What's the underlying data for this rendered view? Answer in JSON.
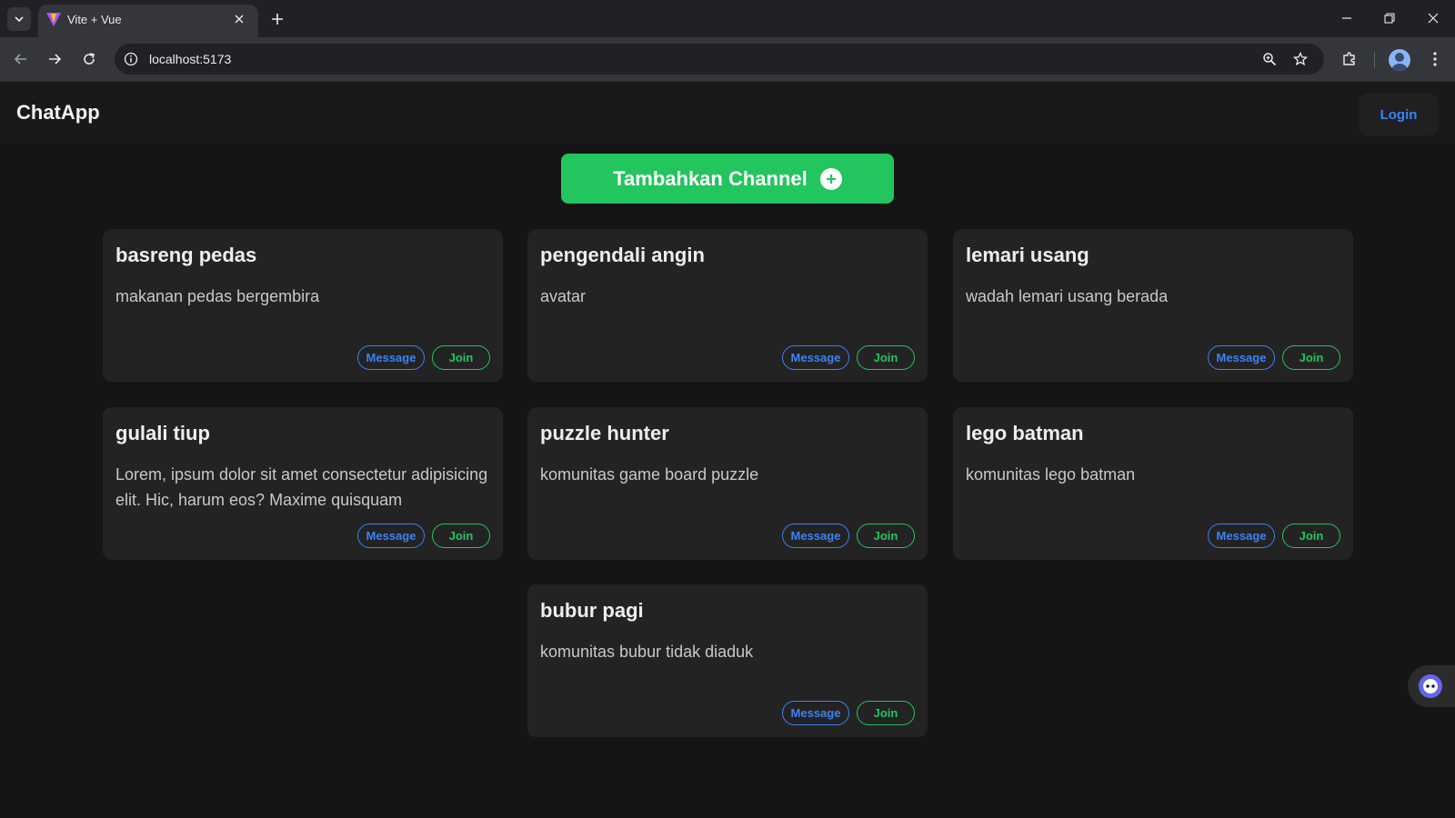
{
  "browser": {
    "tab_title": "Vite + Vue",
    "url": "localhost:5173"
  },
  "app": {
    "brand": "ChatApp",
    "login_label": "Login",
    "add_channel_label": "Tambahkan Channel"
  },
  "colors": {
    "accent_green": "#22c55e",
    "accent_blue": "#3b82f6",
    "card_bg": "#232323",
    "page_bg": "#151515"
  },
  "channels": [
    {
      "name": "basreng pedas",
      "description": "makanan pedas bergembira",
      "message_label": "Message",
      "join_label": "Join"
    },
    {
      "name": "pengendali angin",
      "description": "avatar",
      "message_label": "Message",
      "join_label": "Join"
    },
    {
      "name": "lemari usang",
      "description": "wadah lemari usang berada",
      "message_label": "Message",
      "join_label": "Join"
    },
    {
      "name": "gulali tiup",
      "description": "Lorem, ipsum dolor sit amet consectetur adipisicing elit. Hic, harum eos? Maxime quisquam",
      "message_label": "Message",
      "join_label": "Join"
    },
    {
      "name": "puzzle hunter",
      "description": "komunitas game board puzzle",
      "message_label": "Message",
      "join_label": "Join"
    },
    {
      "name": "lego batman",
      "description": "komunitas lego batman",
      "message_label": "Message",
      "join_label": "Join"
    },
    {
      "name": "bubur pagi",
      "description": "komunitas bubur tidak diaduk",
      "message_label": "Message",
      "join_label": "Join"
    }
  ]
}
